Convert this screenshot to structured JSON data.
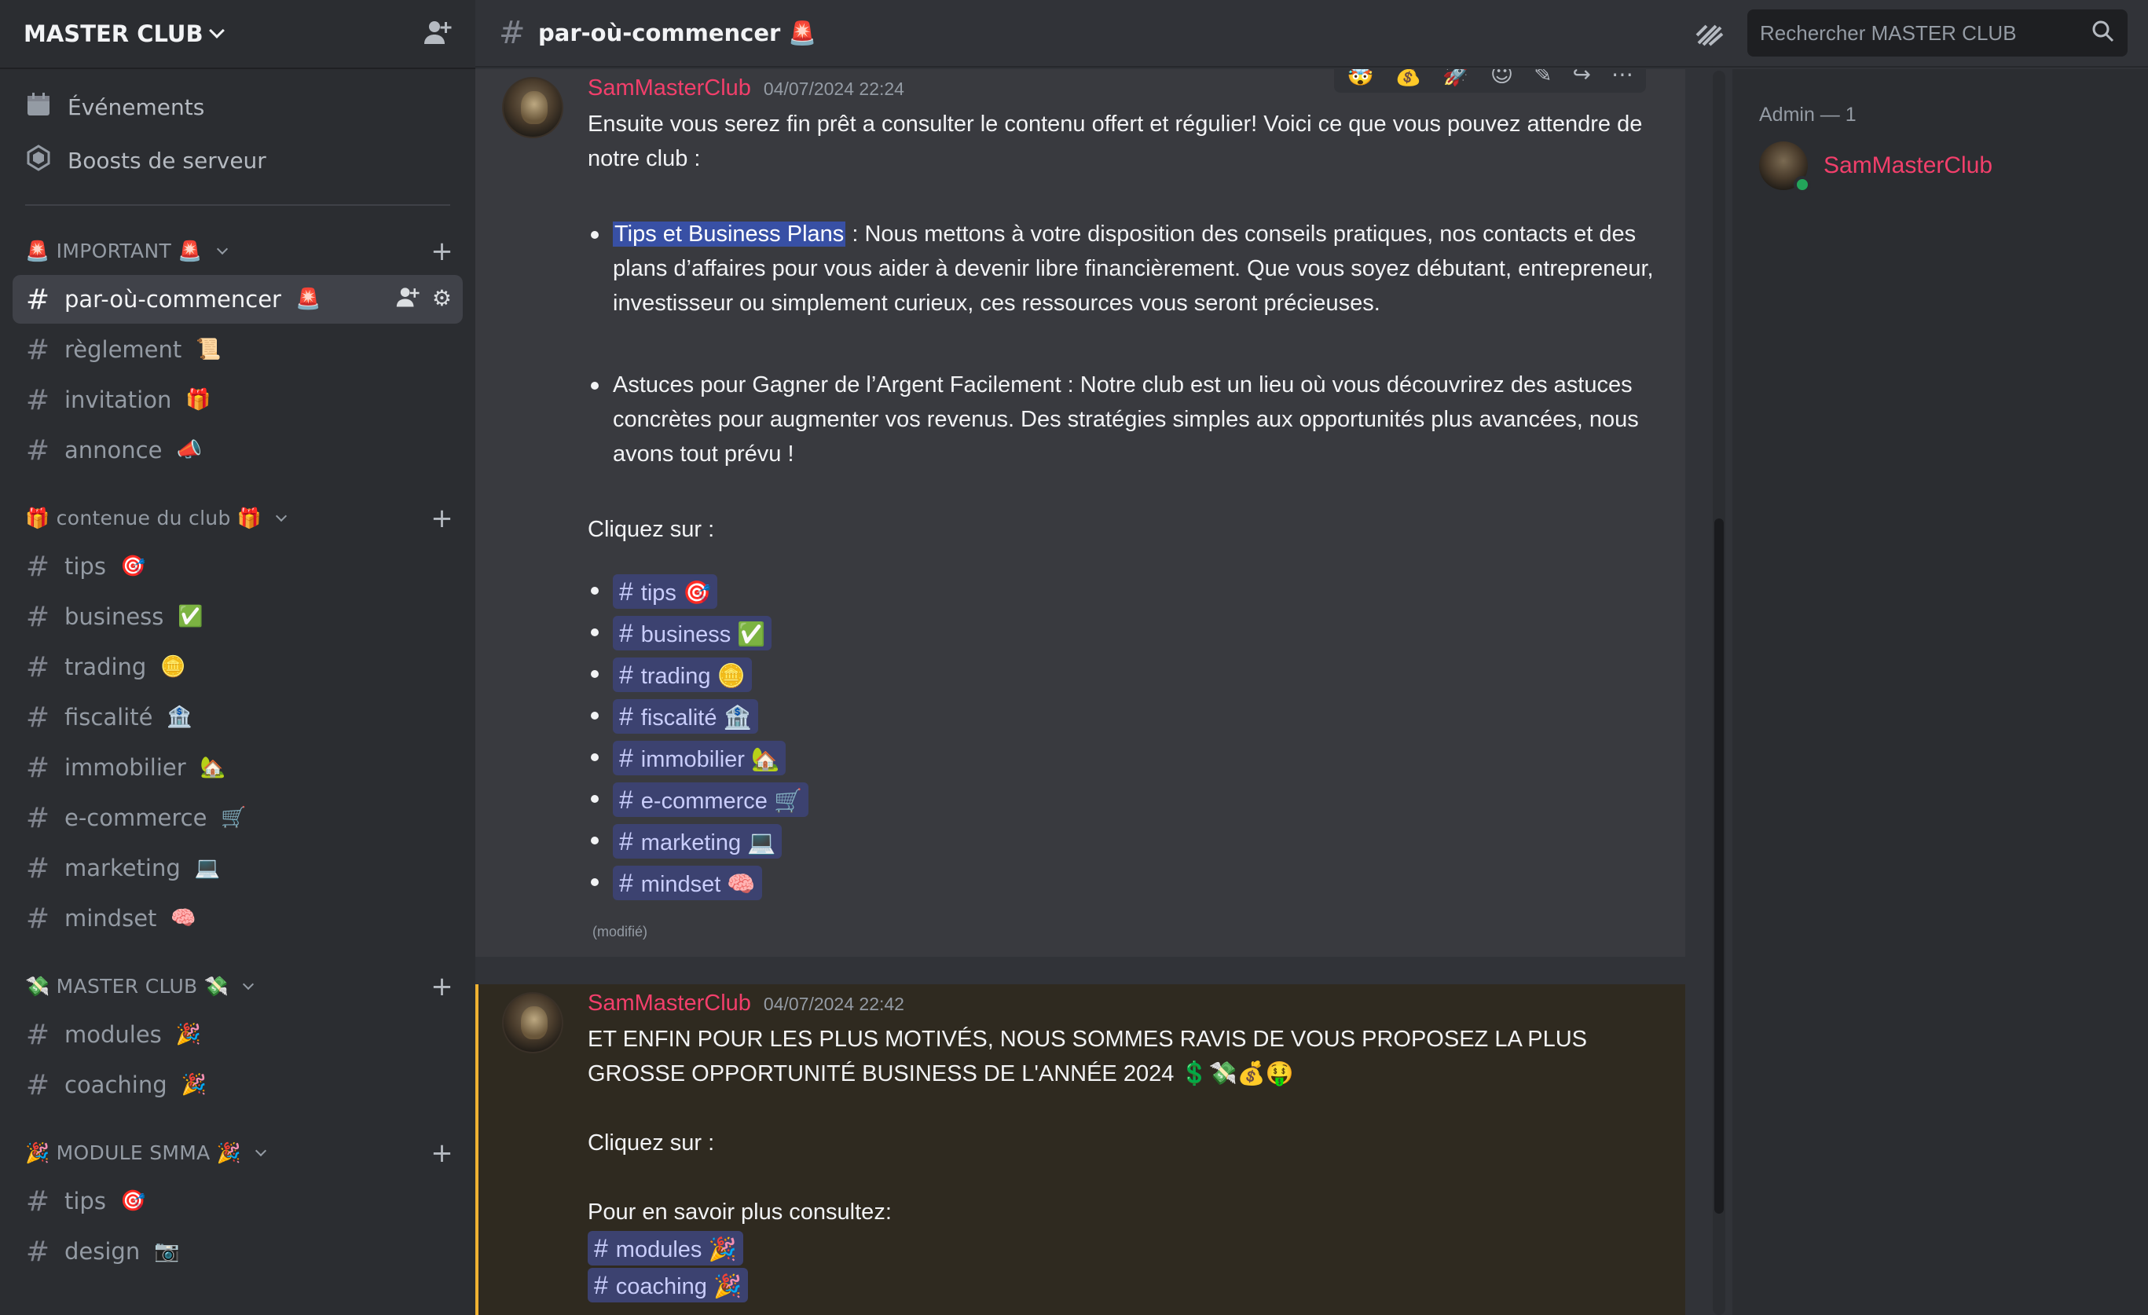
{
  "server": {
    "name": "MASTER CLUB",
    "invite_icon": "add-member-icon"
  },
  "sidebar": {
    "top_items": [
      {
        "label": "Événements",
        "icon": "calendar-icon"
      },
      {
        "label": "Boosts de serveur",
        "icon": "boost-icon"
      }
    ],
    "categories": [
      {
        "label": "🚨 IMPORTANT 🚨",
        "channels": [
          {
            "label": "par-où-commencer",
            "emoji": "🚨",
            "active": true
          },
          {
            "label": "règlement",
            "emoji": "📜"
          },
          {
            "label": "invitation",
            "emoji": "🎁"
          },
          {
            "label": "annonce",
            "emoji": "📣"
          }
        ]
      },
      {
        "label": "🎁 contenue du club 🎁",
        "channels": [
          {
            "label": "tips",
            "emoji": "🎯"
          },
          {
            "label": "business",
            "emoji": "✅"
          },
          {
            "label": "trading",
            "emoji": "🪙"
          },
          {
            "label": "fiscalité",
            "emoji": "🏦"
          },
          {
            "label": "immobilier",
            "emoji": "🏡"
          },
          {
            "label": "e-commerce",
            "emoji": "🛒"
          },
          {
            "label": "marketing",
            "emoji": "💻"
          },
          {
            "label": "mindset",
            "emoji": "🧠"
          }
        ]
      },
      {
        "label": "💸 MASTER CLUB 💸",
        "channels": [
          {
            "label": "modules",
            "emoji": "🎉"
          },
          {
            "label": "coaching",
            "emoji": "🎉"
          }
        ]
      },
      {
        "label": "🎉 MODULE SMMA 🎉",
        "channels": [
          {
            "label": "tips",
            "emoji": "🎯"
          },
          {
            "label": "design",
            "emoji": "📷"
          }
        ]
      }
    ]
  },
  "topbar": {
    "channel_name": "par-où-commencer 🚨",
    "icons": [
      "threads-icon",
      "bell-icon",
      "pin-icon",
      "members-icon"
    ],
    "search_placeholder": "Rechercher MASTER CLUB"
  },
  "messages": [
    {
      "author": "SamMasterClub",
      "timestamp": "04/07/2024 22:24",
      "intro": "Ensuite vous serez fin prêt a consulter le contenu offert et régulier!  Voici ce que vous pouvez attendre de notre club :",
      "bullet1_highlight": "Tips et Business Plans",
      "bullet1_rest": " : Nous mettons à votre disposition des conseils pratiques, nos contacts et des plans d’affaires pour vous aider à devenir libre financièrement. Que vous soyez débutant, entrepreneur, investisseur ou simplement curieux, ces ressources vous seront précieuses.",
      "bullet2": "Astuces pour Gagner de l’Argent Facilement : Notre club est un lieu où vous découvrirez des astuces concrètes pour augmenter vos revenus. Des stratégies simples aux opportunités plus avancées, nous avons tout prévu !",
      "click_label": "Cliquez sur :",
      "channel_links": [
        "tips 🎯",
        "business ✅",
        "trading 🪙",
        "fiscalité 🏦",
        "immobilier 🏡",
        "e-commerce 🛒",
        "marketing 💻",
        "mindset 🧠"
      ],
      "edited": "(modifié)",
      "toolbar_reactions": [
        "🤯",
        "💰",
        "🚀"
      ]
    },
    {
      "author": "SamMasterClub",
      "timestamp": "04/07/2024 22:42",
      "line1": "ET ENFIN POUR LES PLUS MOTIVÉS, NOUS SOMMES RAVIS DE VOUS PROPOSEZ LA PLUS GROSSE OPPORTUNITÉ BUSINESS DE L'ANNÉE 2024 💲💸💰🤑",
      "click_label": "Cliquez sur :",
      "more_label": "Pour en savoir plus consultez:",
      "channel_links": [
        "modules 🎉",
        "coaching 🎉"
      ]
    }
  ],
  "members": {
    "role_header": "Admin — 1",
    "list": [
      {
        "name": "SamMasterClub",
        "status": "online"
      }
    ]
  },
  "colors": {
    "accent": "#f23f6b",
    "mention_chip": "#3c4270",
    "online": "#23a55a",
    "mention_border": "#f0b232"
  }
}
